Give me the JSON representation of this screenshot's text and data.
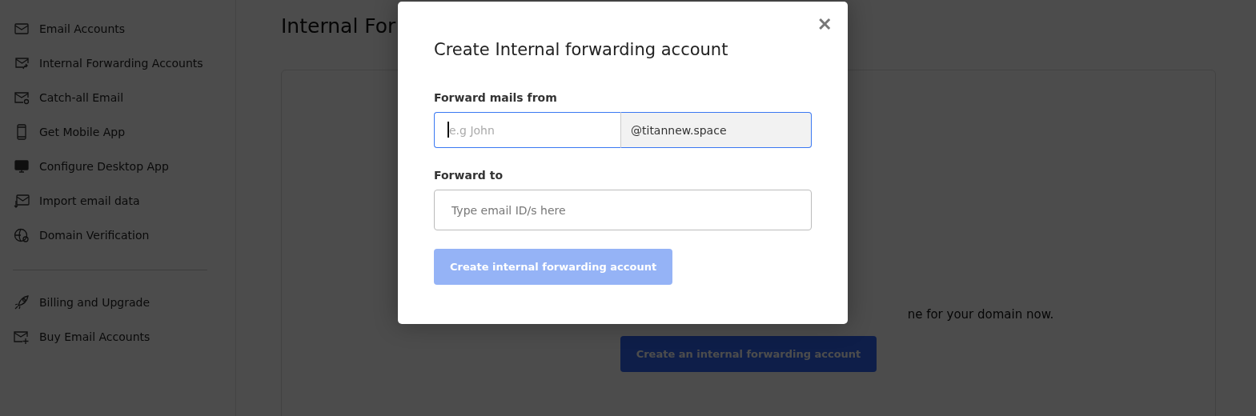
{
  "sidebar": {
    "items": [
      {
        "label": "Email Accounts",
        "kind": "mail"
      },
      {
        "label": "Internal Forwarding Accounts",
        "kind": "forward"
      },
      {
        "label": "Catch-all Email",
        "kind": "catchall"
      },
      {
        "label": "Get Mobile App",
        "kind": "mobile"
      },
      {
        "label": "Configure Desktop App",
        "kind": "desktop"
      },
      {
        "label": "Import email data",
        "kind": "import"
      },
      {
        "label": "Domain Verification",
        "kind": "globe"
      }
    ],
    "bottom_items": [
      {
        "label": "Billing and Upgrade",
        "kind": "rocket"
      },
      {
        "label": "Buy Email Accounts",
        "kind": "buy"
      }
    ]
  },
  "page": {
    "title": "Internal For",
    "description": "ne for your domain now.",
    "button": "Create an internal forwarding account"
  },
  "modal": {
    "title": "Create Internal forwarding account",
    "close": "✕",
    "from": {
      "label": "Forward mails from",
      "placeholder": "e.g John",
      "focused": true,
      "domain": "@titannew.space"
    },
    "to": {
      "label": "Forward to",
      "placeholder": "Type email ID/s here"
    },
    "submit": {
      "label": "Create internal forwarding account",
      "disabled": true
    }
  }
}
